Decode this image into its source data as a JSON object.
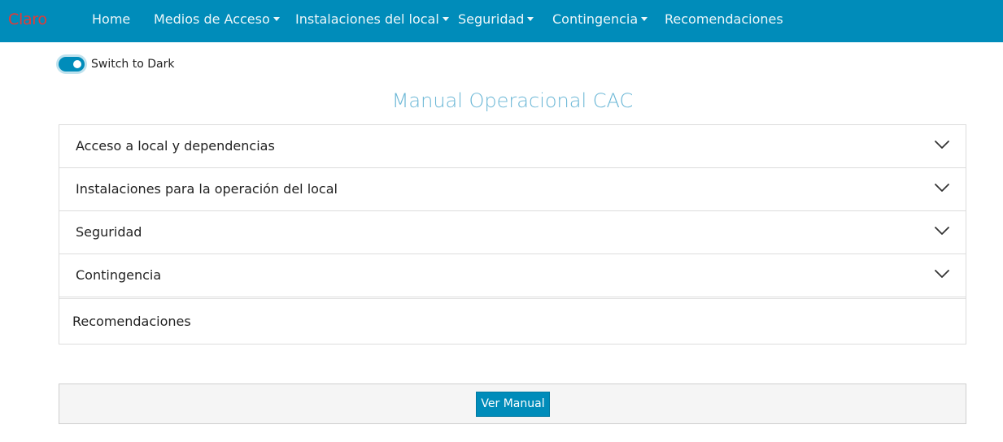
{
  "navbar": {
    "brand": "Claro",
    "items": [
      {
        "label": "Home",
        "dropdown": false
      },
      {
        "label": "Medios de Acceso",
        "dropdown": true
      },
      {
        "label": "Instalaciones del local",
        "dropdown": true
      },
      {
        "label": "Seguridad",
        "dropdown": true
      },
      {
        "label": "Contingencia",
        "dropdown": true
      },
      {
        "label": "Recomendaciones",
        "dropdown": false
      }
    ]
  },
  "theme_switch": {
    "label": "Switch to Dark",
    "checked": true
  },
  "page": {
    "title": "Manual Operacional CAC"
  },
  "accordion": {
    "items": [
      {
        "label": "Acceso a local y dependencias",
        "icon": "chevron-down-icon"
      },
      {
        "label": "Instalaciones para la operación del local",
        "icon": "chevron-down-icon"
      },
      {
        "label": "Seguridad",
        "icon": "chevron-down-icon"
      },
      {
        "label": "Contingencia",
        "icon": "chevron-down-icon"
      }
    ],
    "plain_item": {
      "label": "Recomendaciones"
    }
  },
  "footer": {
    "button_label": "Ver Manual"
  },
  "colors": {
    "primary": "#008cba",
    "brand": "#e53935",
    "title": "#6bb7d6"
  }
}
